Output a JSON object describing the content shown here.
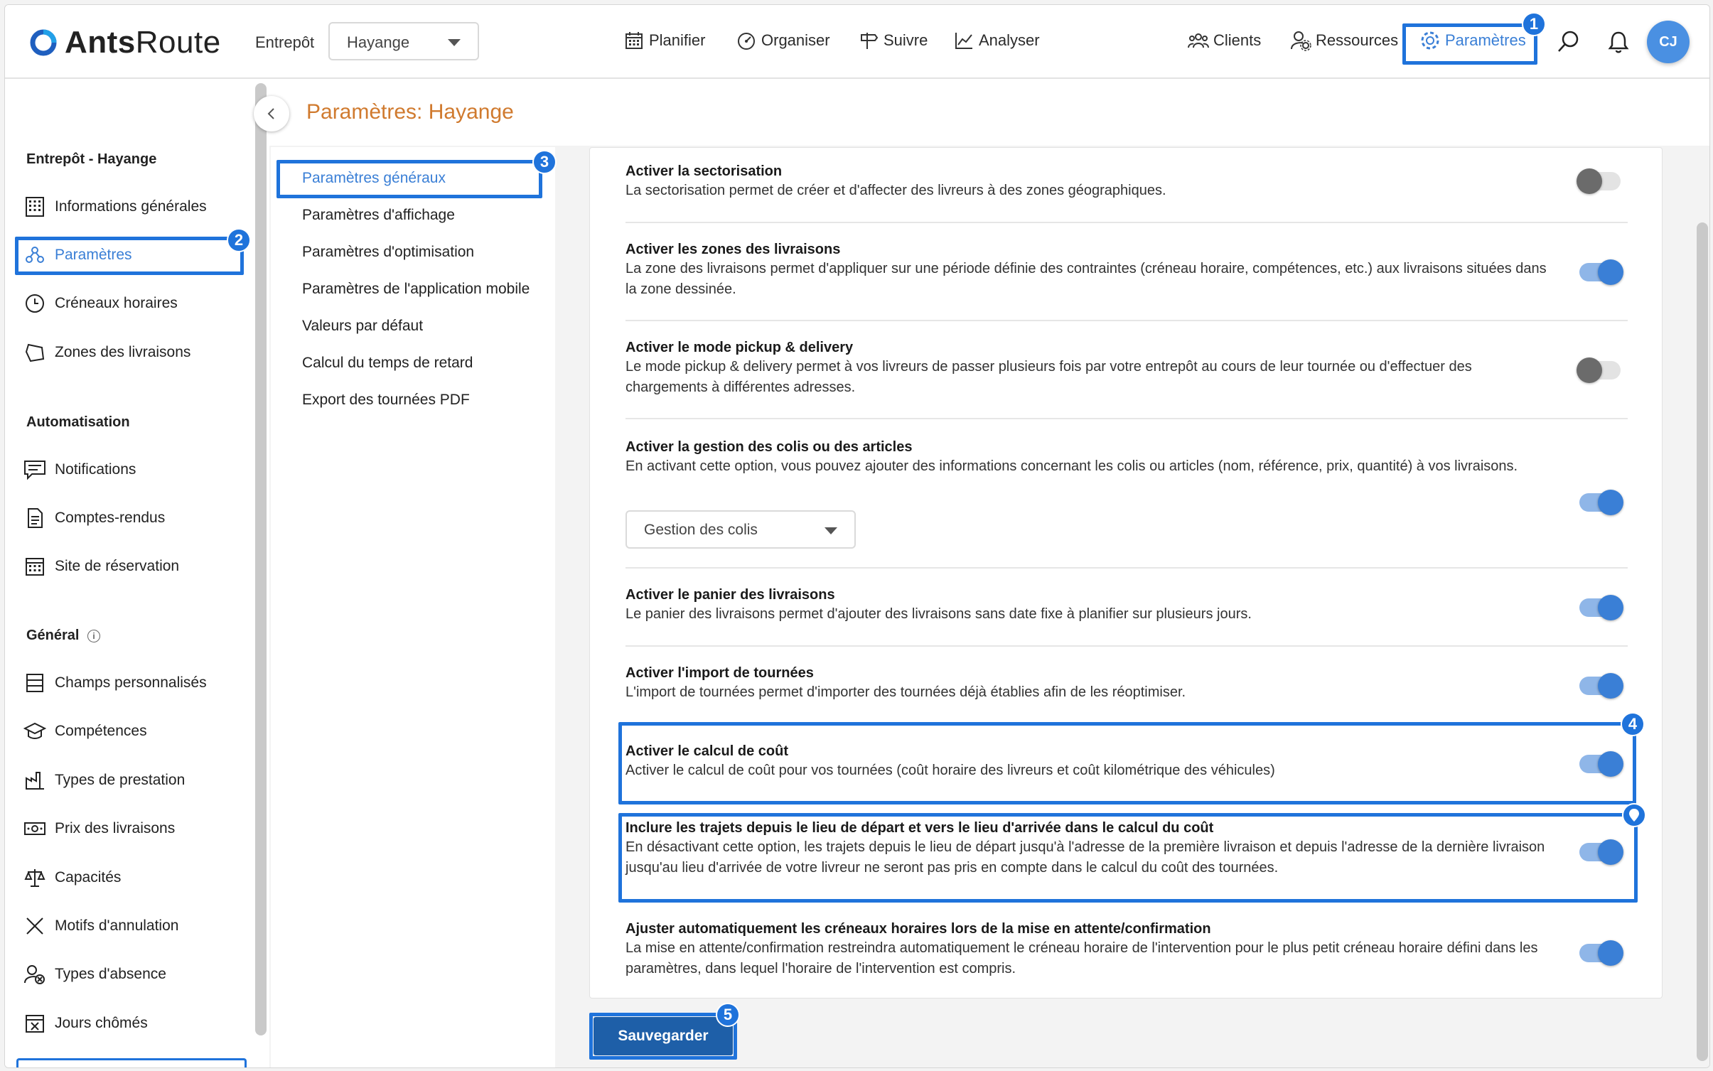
{
  "header": {
    "logo": "AntsRoute",
    "warehouse_label": "Entrepôt",
    "warehouse_value": "Hayange",
    "nav": [
      {
        "label": "Planifier",
        "icon": "calendar-icon"
      },
      {
        "label": "Organiser",
        "icon": "gauge-icon"
      },
      {
        "label": "Suivre",
        "icon": "signpost-icon"
      },
      {
        "label": "Analyser",
        "icon": "chart-icon"
      }
    ],
    "right_nav": [
      {
        "label": "Clients",
        "icon": "users-icon"
      },
      {
        "label": "Ressources",
        "icon": "user-gear-icon"
      },
      {
        "label": "Paramètres",
        "icon": "gear-icon"
      }
    ],
    "avatar": "CJ"
  },
  "badges": {
    "b1": "1",
    "b2": "2",
    "b3": "3",
    "b4": "4",
    "b5": "5"
  },
  "sidebar": {
    "warehouse_title": "Entrepôt - Hayange",
    "section_auto": "Automatisation",
    "section_general": "Général",
    "items": [
      {
        "label": "Informations générales",
        "icon": "building-icon"
      },
      {
        "label": "Paramètres",
        "icon": "settings-nodes-icon"
      },
      {
        "label": "Créneaux horaires",
        "icon": "clock-icon"
      },
      {
        "label": "Zones des livraisons",
        "icon": "zone-icon"
      },
      {
        "label": "Notifications",
        "icon": "message-icon"
      },
      {
        "label": "Comptes-rendus",
        "icon": "document-icon"
      },
      {
        "label": "Site de réservation",
        "icon": "calendar-grid-icon"
      },
      {
        "label": "Champs personnalisés",
        "icon": "fields-icon"
      },
      {
        "label": "Compétences",
        "icon": "graduation-cap-icon"
      },
      {
        "label": "Types de prestation",
        "icon": "factory-icon"
      },
      {
        "label": "Prix des livraisons",
        "icon": "banknote-icon"
      },
      {
        "label": "Capacités",
        "icon": "scale-icon"
      },
      {
        "label": "Motifs d'annulation",
        "icon": "x-icon"
      },
      {
        "label": "Types d'absence",
        "icon": "user-x-icon"
      },
      {
        "label": "Jours chômés",
        "icon": "calendar-x-icon"
      }
    ]
  },
  "page": {
    "title": "Paramètres: Hayange"
  },
  "subnav": [
    "Paramètres généraux",
    "Paramètres d'affichage",
    "Paramètres d'optimisation",
    "Paramètres de l'application mobile",
    "Valeurs par défaut",
    "Calcul du temps de retard",
    "Export des tournées PDF"
  ],
  "settings": [
    {
      "title": "Activer la sectorisation",
      "desc": "La sectorisation permet de créer et d'affecter des livreurs à des zones géographiques.",
      "enabled": false
    },
    {
      "title": "Activer les zones des livraisons",
      "desc": "La zone des livraisons permet d'appliquer sur une période définie des contraintes (créneau horaire, compétences, etc.) aux livraisons situées dans la zone dessinée.",
      "enabled": true
    },
    {
      "title": "Activer le mode pickup & delivery",
      "desc": "Le mode pickup & delivery permet à vos livreurs de passer plusieurs fois par votre entrepôt au cours de leur tournée ou d'effectuer des chargements à différentes adresses.",
      "enabled": false
    },
    {
      "title": "Activer la gestion des colis ou des articles",
      "desc": "En activant cette option, vous pouvez ajouter des informations concernant les colis ou articles (nom, référence, prix, quantité) à vos livraisons.",
      "enabled": true,
      "select_value": "Gestion des colis"
    },
    {
      "title": "Activer le panier des livraisons",
      "desc": "Le panier des livraisons permet d'ajouter des livraisons sans date fixe à planifier sur plusieurs jours.",
      "enabled": true
    },
    {
      "title": "Activer l'import de tournées",
      "desc": "L'import de tournées permet d'importer des tournées déjà établies afin de les réoptimiser.",
      "enabled": true
    },
    {
      "title": "Activer le calcul de coût",
      "desc": "Activer le calcul de coût pour vos tournées (coût horaire des livreurs et coût kilométrique des véhicules)",
      "enabled": true
    },
    {
      "title": "Inclure les trajets depuis le lieu de départ et vers le lieu d'arrivée dans le calcul du coût",
      "desc": "En désactivant cette option, les trajets depuis le lieu de départ jusqu'à l'adresse de la première livraison et depuis l'adresse de la dernière livraison jusqu'au lieu d'arrivée de votre livreur ne seront pas pris en compte dans le calcul du coût des tournées.",
      "enabled": true
    },
    {
      "title": "Ajuster automatiquement les créneaux horaires lors de la mise en attente/confirmation",
      "desc": "La mise en attente/confirmation restreindra automatiquement le créneau horaire de l'intervention pour le plus petit créneau horaire défini dans les paramètres, dans lequel l'horaire de l'intervention est compris.",
      "enabled": true
    }
  ],
  "save_label": "Sauvegarder",
  "colors": {
    "accent": "#3a7fd6",
    "highlight": "#1f73db",
    "title": "#d07a2e",
    "save": "#1e5fa8"
  }
}
